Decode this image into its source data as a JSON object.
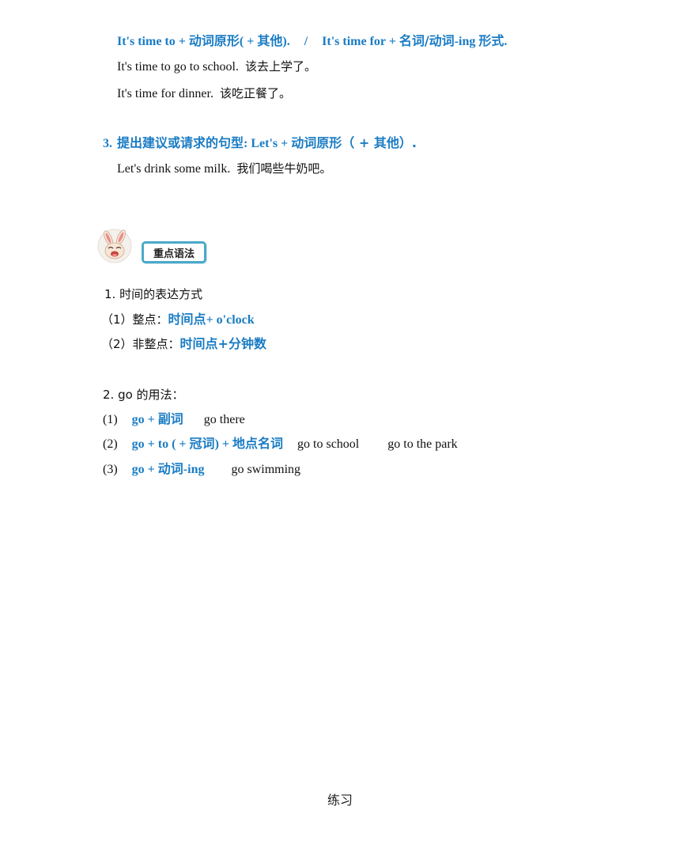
{
  "section_sentence_patterns": {
    "time_rule": {
      "part1_en": "It's time to + ",
      "part1_cn": "动词原形",
      "part1_tail_en": "( + ",
      "part1_tail_cn": "其他",
      "part1_end": ").",
      "separator": "/",
      "part2_en": "It's time for + ",
      "part2_cn": "名词/动词",
      "part2_en2": "-ing ",
      "part2_cn2": "形式",
      "part2_end": "."
    },
    "examples": [
      {
        "en": "It's time to go to school.",
        "cn": "该去上学了。"
      },
      {
        "en": "It's time for dinner.",
        "cn": "该吃正餐了。"
      }
    ],
    "rule3": {
      "number": "3.",
      "cn": "提出建议或请求的句型",
      "en": ": Let's + ",
      "cn2": "动词原形",
      "paren_open": "（ + ",
      "cn3": "其他",
      "paren_close": "）."
    },
    "rule3_example": {
      "en": "Let's drink some milk.",
      "cn": "我们喝些牛奶吧。"
    }
  },
  "grammar_section": {
    "icon": "rabbit-icon",
    "badge_label": "重点语法",
    "time_expression": {
      "title": "1. 时间的表达方式",
      "items": [
        {
          "label": "（1）整点：",
          "rule_cn": "时间点",
          "rule_en": "+ o'clock"
        },
        {
          "label": "（2）非整点：",
          "rule_cn": "时间点+分钟数",
          "rule_en": ""
        }
      ]
    },
    "go_usage": {
      "title": "2. go 的用法：",
      "items": [
        {
          "num": "(1)",
          "rule_a": "go + ",
          "rule_cn": "副词",
          "rule_b": "",
          "rule_cn2": "",
          "examples": [
            "go there"
          ]
        },
        {
          "num": "(2)",
          "rule_a": "go + to ( + ",
          "rule_cn": "冠词",
          "rule_b": ") + ",
          "rule_cn2": "地点名词",
          "examples": [
            "go to school",
            "go to the park"
          ]
        },
        {
          "num": "(3)",
          "rule_a": "go + ",
          "rule_cn": "动词",
          "rule_b": "-ing",
          "rule_cn2": "",
          "examples": [
            "go swimming"
          ]
        }
      ]
    }
  },
  "footer": {
    "label": "练习"
  },
  "colors": {
    "accent_blue": "#1a7cc4",
    "badge_border": "#4aa9c9"
  }
}
